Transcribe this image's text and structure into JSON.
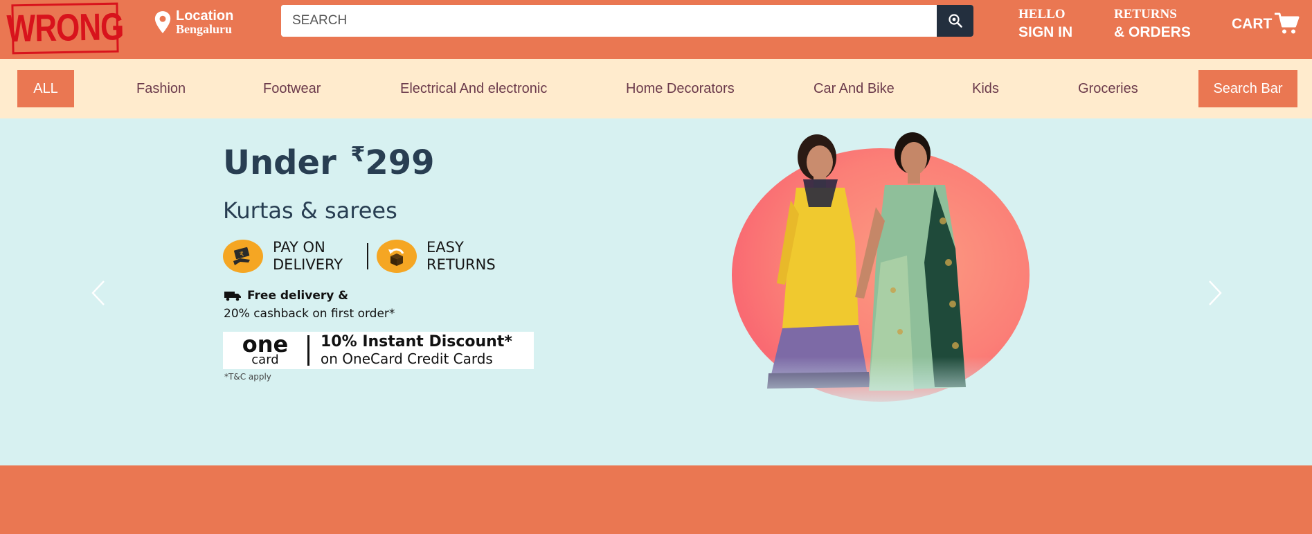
{
  "header": {
    "logo_text": "WRONG",
    "location": {
      "title": "Location",
      "city": "Bengaluru"
    },
    "search": {
      "placeholder": "SEARCH"
    },
    "account": {
      "greeting": "HELLO",
      "action": "SIGN IN"
    },
    "orders": {
      "line1": "RETURNS",
      "line2": "& ORDERS"
    },
    "cart": {
      "label": "CART"
    }
  },
  "categories": {
    "all_label": "ALL",
    "items": [
      "Fashion",
      "Footwear",
      "Electrical And electronic",
      "Home Decorators",
      "Car And Bike",
      "Kids",
      "Groceries"
    ],
    "search_button": "Search Bar"
  },
  "hero": {
    "title_prefix": "Under",
    "currency": "₹",
    "price": "299",
    "subtitle": "Kurtas & sarees",
    "feature_pay": {
      "line1": "PAY ON",
      "line2": "DELIVERY"
    },
    "feature_returns": {
      "line1": "EASY",
      "line2": "RETURNS"
    },
    "delivery_line1": "Free delivery &",
    "delivery_line2": "20% cashback on first order*",
    "onecard": {
      "logo_one": "one",
      "logo_card": "card",
      "line1": "10% Instant Discount*",
      "line2": "on OneCard Credit Cards"
    },
    "terms": "*T&C apply"
  },
  "colors": {
    "brand": "#ea7752",
    "category_bar": "#ffebcd",
    "hero_bg": "#d7f1f1",
    "search_button": "#232f3e",
    "category_text": "#6b3a4b",
    "logo_red": "#d8131c"
  }
}
